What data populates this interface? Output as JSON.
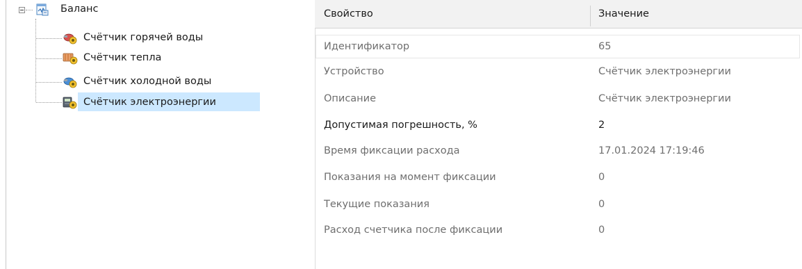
{
  "tree": {
    "root": {
      "label": "Баланс",
      "expanded": true
    },
    "children": [
      {
        "label": "Счётчик горячей воды",
        "icon": "hot-water-meter-icon",
        "selected": false
      },
      {
        "label": "Счётчик тепла",
        "icon": "heat-meter-icon",
        "selected": false
      },
      {
        "label": "Счётчик холодной воды",
        "icon": "cold-water-meter-icon",
        "selected": false
      },
      {
        "label": "Счётчик электроэнергии",
        "icon": "electricity-meter-icon",
        "selected": true
      }
    ]
  },
  "grid": {
    "columns": [
      "Свойство",
      "Значение"
    ],
    "rows": [
      {
        "property": "Идентификатор",
        "value": "65",
        "editable": false
      },
      {
        "property": "Устройство",
        "value": "Счётчик электроэнергии",
        "editable": false
      },
      {
        "property": "Описание",
        "value": "Счётчик электроэнергии",
        "editable": false
      },
      {
        "property": "Допустимая погрешность, %",
        "value": "2",
        "editable": true
      },
      {
        "property": "Время фиксации расхода",
        "value": "17.01.2024 17:19:46",
        "editable": false
      },
      {
        "property": "Показания на момент фиксации",
        "value": "0",
        "editable": false
      },
      {
        "property": "Текущие показания",
        "value": "0",
        "editable": false
      },
      {
        "property": "Расход счетчика после фиксации",
        "value": "0",
        "editable": false
      }
    ]
  },
  "colors": {
    "selection": "#cce8ff",
    "header_bg": "#f2f2f2",
    "readonly_text": "#6e6e6e",
    "active_text": "#1a1a1a"
  }
}
